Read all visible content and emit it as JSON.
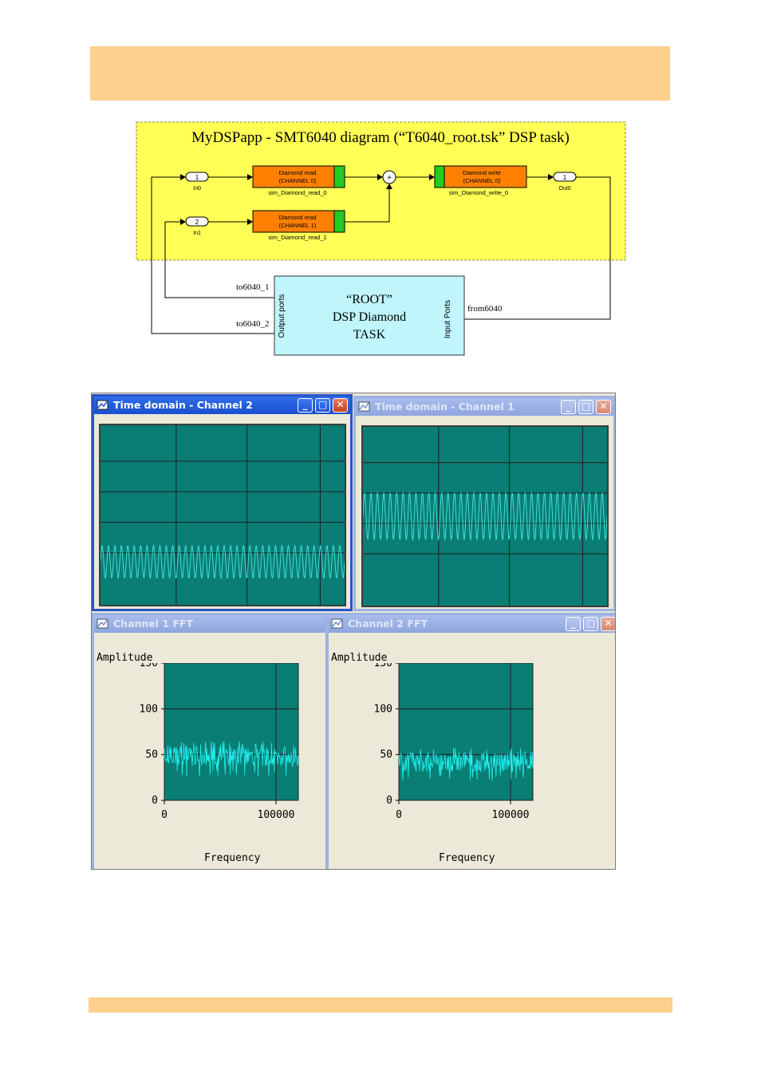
{
  "diagram": {
    "title": "MyDSPapp - SMT6040 diagram (“T6040_root.tsk” DSP task)",
    "blocks": [
      {
        "line1": "Diamond read",
        "line2": "(CHANNEL 0)",
        "caption": "sim_Diamond_read_0"
      },
      {
        "line1": "Diamond read",
        "line2": "(CHANNEL 1)",
        "caption": "sim_Diamond_read_1"
      },
      {
        "line1": "Diamond write",
        "line2": "(CHANNEL 0)",
        "caption": "sim_Diamond_write_0"
      }
    ],
    "ports": [
      {
        "num": "1",
        "label": "In0"
      },
      {
        "num": "2",
        "label": "In1"
      },
      {
        "num": "1",
        "label": "Out0"
      }
    ],
    "sum_symbol": "+",
    "root_task": {
      "line1": "“ROOT”",
      "line2": "DSP Diamond",
      "line3": "TASK",
      "output_ports": "Output ports",
      "input_ports": "Input Ports"
    },
    "signals": {
      "to1": "to6040_1",
      "to2": "to6040_2",
      "from": "from6040"
    }
  },
  "windows": {
    "time_ch2": {
      "title": "Time domain - Channel 2"
    },
    "time_ch1": {
      "title": "Time domain - Channel 1"
    },
    "fft_ch1": {
      "title": "Channel 1 FFT",
      "ylabel": "Amplitude",
      "xlabel": "Frequency",
      "yticks": [
        "150",
        "100",
        "50",
        "0"
      ],
      "xticks": [
        "0",
        "100000"
      ]
    },
    "fft_ch2": {
      "title": "Channel 2 FFT",
      "ylabel": "Amplitude",
      "xlabel": "Frequency",
      "yticks": [
        "150",
        "100",
        "50",
        "0"
      ],
      "xticks": [
        "0",
        "100000"
      ]
    }
  },
  "window_buttons": {
    "minimize": "_",
    "maximize": "□",
    "close": "✕"
  },
  "chart_data": [
    {
      "type": "line",
      "title": "Time domain - Channel 2",
      "description_series": "sine wave",
      "waveform": "sinusoid",
      "cycles_visible": 38,
      "level_fraction": 0.76,
      "amplitude_fraction": 0.09,
      "grid": true,
      "color": "#3ee0d8"
    },
    {
      "type": "line",
      "title": "Time domain - Channel 1",
      "waveform": "sinusoid",
      "cycles_visible": 38,
      "level_fraction": 0.5,
      "amplitude_fraction": 0.13,
      "grid": true,
      "color": "#3ee0d8"
    },
    {
      "type": "line",
      "title": "Channel 1 FFT",
      "xlabel": "Frequency",
      "ylabel": "Amplitude",
      "ylim": [
        0,
        150
      ],
      "xlim": [
        0,
        120000
      ],
      "noise_floor_mean": 48,
      "noise_band": [
        25,
        65
      ],
      "grid": true,
      "color": "#22f0f0"
    },
    {
      "type": "line",
      "title": "Channel 2 FFT",
      "xlabel": "Frequency",
      "ylabel": "Amplitude",
      "ylim": [
        0,
        150
      ],
      "xlim": [
        0,
        120000
      ],
      "noise_floor_mean": 42,
      "noise_band": [
        20,
        60
      ],
      "grid": true,
      "color": "#22f0f0"
    }
  ],
  "colors": {
    "band": "#fdd08e",
    "diagram_bg": "#ffff55",
    "block": "#ff8000",
    "root_task": "#bff5fb",
    "scope_bg": "#0a7d74",
    "trace": "#3ee0d8",
    "xp_title": "#2a55c9"
  }
}
